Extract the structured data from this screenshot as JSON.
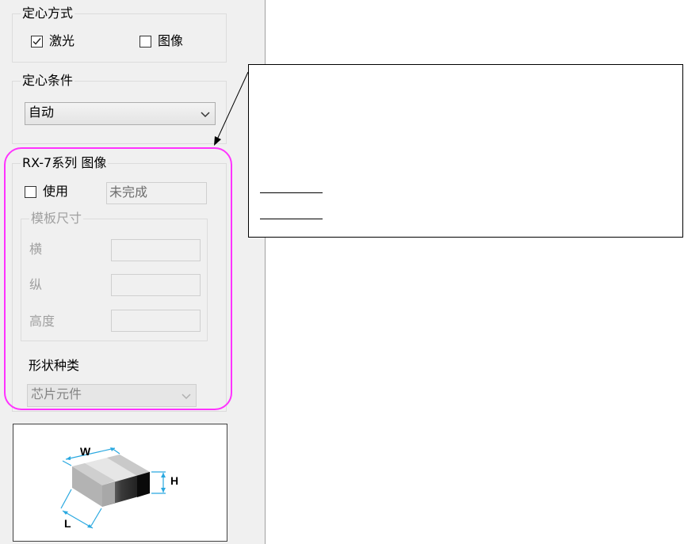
{
  "centering_method": {
    "title": "定心方式",
    "laser": {
      "label": "激光",
      "checked": true
    },
    "image": {
      "label": "图像",
      "checked": false
    }
  },
  "centering_condition": {
    "title": "定心条件",
    "selected": "自动"
  },
  "rx7_image": {
    "title": "RX-7系列 图像",
    "use": {
      "label": "使用",
      "checked": false
    },
    "status_value": "未完成",
    "template_size": {
      "title": "模板尺寸",
      "width_label": "横",
      "length_label": "纵",
      "height_label": "高度"
    },
    "shape_type": {
      "title": "形状种类",
      "selected": "芯片元件"
    }
  },
  "component_diagram": {
    "w_label": "W",
    "h_label": "H",
    "l_label": "L"
  },
  "colors": {
    "highlight": "#ff33ff",
    "dimension_lines": "#29a8e0"
  }
}
